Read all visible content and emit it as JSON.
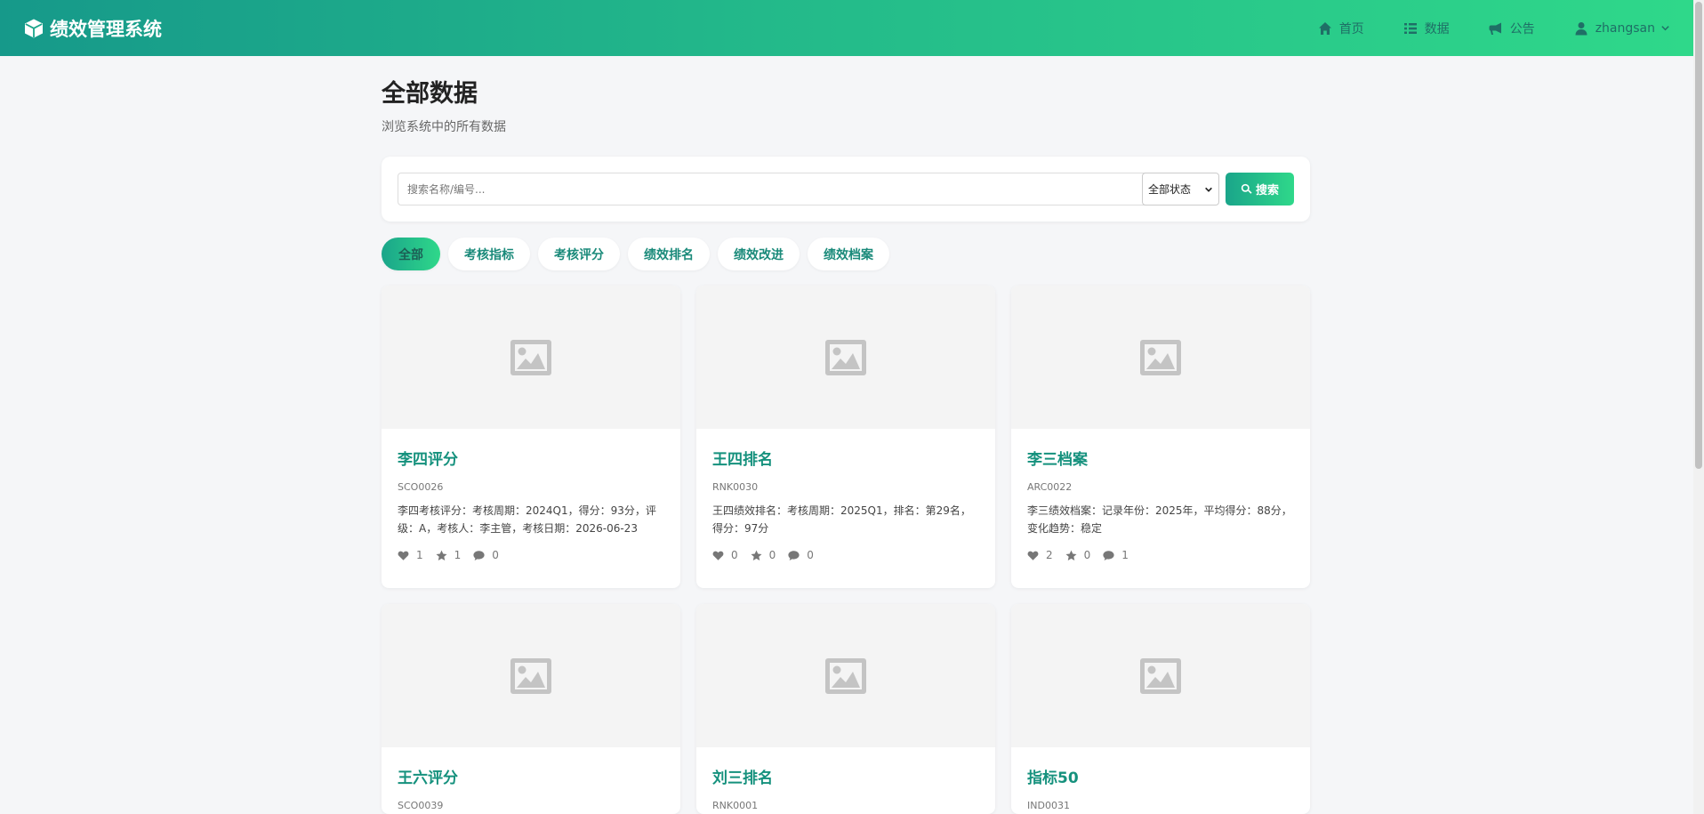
{
  "brand": {
    "title": "绩效管理系统",
    "icon": "cube-icon"
  },
  "nav": {
    "home": "首页",
    "data": "数据",
    "notice": "公告",
    "user": "zhangsan"
  },
  "page": {
    "title": "全部数据",
    "subtitle": "浏览系统中的所有数据"
  },
  "search": {
    "placeholder": "搜索名称/编号...",
    "value": "",
    "status_selected": "全部状态",
    "button_label": "搜索"
  },
  "tabs": [
    {
      "label": "全部",
      "active": true
    },
    {
      "label": "考核指标",
      "active": false
    },
    {
      "label": "考核评分",
      "active": false
    },
    {
      "label": "绩效排名",
      "active": false
    },
    {
      "label": "绩效改进",
      "active": false
    },
    {
      "label": "绩效档案",
      "active": false
    }
  ],
  "cards": [
    {
      "title": "李四评分",
      "code": "SCO0026",
      "desc": "李四考核评分：考核周期：2024Q1，得分：93分，评级：A，考核人：李主管，考核日期：2026-06-23",
      "likes": "1",
      "stars": "1",
      "comments": "0"
    },
    {
      "title": "王四排名",
      "code": "RNK0030",
      "desc": "王四绩效排名：考核周期：2025Q1，排名：第29名，得分：97分",
      "likes": "0",
      "stars": "0",
      "comments": "0"
    },
    {
      "title": "李三档案",
      "code": "ARC0022",
      "desc": "李三绩效档案：记录年份：2025年，平均得分：88分，变化趋势：稳定",
      "likes": "2",
      "stars": "0",
      "comments": "1"
    },
    {
      "title": "王六评分",
      "code": "SCO0039",
      "desc": "",
      "likes": "",
      "stars": "",
      "comments": ""
    },
    {
      "title": "刘三排名",
      "code": "RNK0001",
      "desc": "",
      "likes": "",
      "stars": "",
      "comments": ""
    },
    {
      "title": "指标50",
      "code": "IND0031",
      "desc": "",
      "likes": "",
      "stars": "",
      "comments": ""
    }
  ],
  "colors": {
    "brand_start": "#16998a",
    "brand_end": "#2fd88a",
    "accent_text": "#15917d",
    "background": "#f5f6f8"
  }
}
